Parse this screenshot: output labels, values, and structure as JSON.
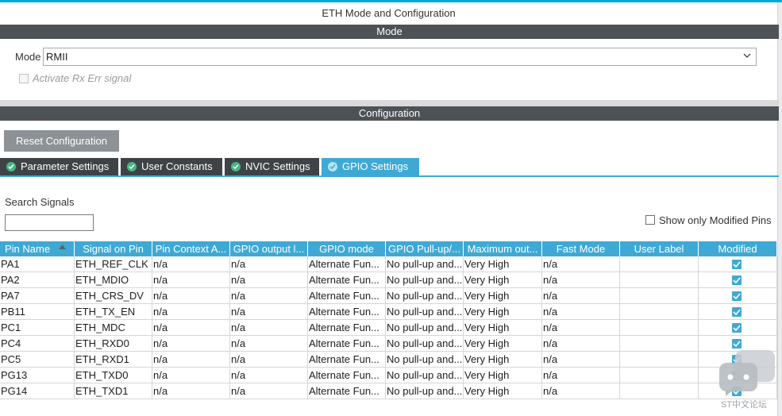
{
  "window": {
    "title": "ETH Mode and Configuration"
  },
  "mode_section": {
    "header": "Mode",
    "mode_label": "Mode",
    "mode_value": "RMII",
    "activate_label": "Activate Rx Err signal"
  },
  "config_section": {
    "header": "Configuration",
    "reset_label": "Reset Configuration",
    "tabs": [
      {
        "label": "Parameter Settings"
      },
      {
        "label": "User Constants"
      },
      {
        "label": "NVIC Settings"
      },
      {
        "label": "GPIO Settings"
      }
    ],
    "search_label": "Search Signals",
    "search_value": "",
    "only_modified_label": "Show only Modified Pins"
  },
  "table": {
    "columns": [
      "Pin Name",
      "Signal on Pin",
      "Pin Context A...",
      "GPIO output l...",
      "GPIO mode",
      "GPIO Pull-up/...",
      "Maximum out...",
      "Fast Mode",
      "User Label",
      "Modified"
    ],
    "rows": [
      [
        "PA1",
        "ETH_REF_CLK",
        "n/a",
        "n/a",
        "Alternate Fun...",
        "No pull-up and...",
        "Very High",
        "n/a",
        "",
        true
      ],
      [
        "PA2",
        "ETH_MDIO",
        "n/a",
        "n/a",
        "Alternate Fun...",
        "No pull-up and...",
        "Very High",
        "n/a",
        "",
        true
      ],
      [
        "PA7",
        "ETH_CRS_DV",
        "n/a",
        "n/a",
        "Alternate Fun...",
        "No pull-up and...",
        "Very High",
        "n/a",
        "",
        true
      ],
      [
        "PB11",
        "ETH_TX_EN",
        "n/a",
        "n/a",
        "Alternate Fun...",
        "No pull-up and...",
        "Very High",
        "n/a",
        "",
        true
      ],
      [
        "PC1",
        "ETH_MDC",
        "n/a",
        "n/a",
        "Alternate Fun...",
        "No pull-up and...",
        "Very High",
        "n/a",
        "",
        true
      ],
      [
        "PC4",
        "ETH_RXD0",
        "n/a",
        "n/a",
        "Alternate Fun...",
        "No pull-up and...",
        "Very High",
        "n/a",
        "",
        true
      ],
      [
        "PC5",
        "ETH_RXD1",
        "n/a",
        "n/a",
        "Alternate Fun...",
        "No pull-up and...",
        "Very High",
        "n/a",
        "",
        true
      ],
      [
        "PG13",
        "ETH_TXD0",
        "n/a",
        "n/a",
        "Alternate Fun...",
        "No pull-up and...",
        "Very High",
        "n/a",
        "",
        true
      ],
      [
        "PG14",
        "ETH_TXD1",
        "n/a",
        "n/a",
        "Alternate Fun...",
        "No pull-up and...",
        "Very High",
        "n/a",
        "",
        true
      ]
    ]
  },
  "watermark": {
    "text": "ST中文论坛"
  },
  "colors": {
    "accent": "#3fa9d5",
    "section_bar": "#4d5257",
    "tab_dark": "#3e4347",
    "reset_button": "#8c9296",
    "tab_check": "#43b97f"
  }
}
